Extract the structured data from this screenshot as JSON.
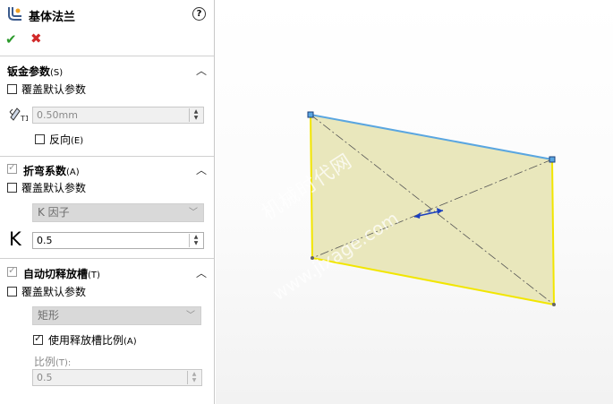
{
  "header": {
    "title": "基体法兰",
    "help_icon": "?"
  },
  "actions": {
    "ok_icon": "✔",
    "cancel_icon": "✖"
  },
  "sheet_metal_params": {
    "heading": "钣金参数",
    "heading_key": "(S)",
    "override_label": "覆盖默认参数",
    "override_checked": false,
    "thickness_value": "0.50mm",
    "reverse_label": "反向",
    "reverse_key": "(E)",
    "reverse_checked": false
  },
  "bend_allowance": {
    "heading": "折弯系数",
    "heading_key": "(A)",
    "enabled_checked": true,
    "override_label": "覆盖默认参数",
    "override_checked": false,
    "type_value": "K 因子",
    "k_symbol": "K",
    "k_value": "0.5"
  },
  "auto_relief": {
    "heading": "自动切释放槽",
    "heading_key": "(T)",
    "enabled_checked": true,
    "override_label": "覆盖默认参数",
    "override_checked": false,
    "type_value": "矩形",
    "use_ratio_label": "使用释放槽比例",
    "use_ratio_key": "(A)",
    "use_ratio_checked": true,
    "ratio_label": "比例",
    "ratio_key": "(T):",
    "ratio_value": "0.5"
  },
  "viewport": {
    "watermark_line1": "机械时代网",
    "watermark_line2": "www.jixage.com"
  },
  "colors": {
    "face_fill": "#e8e6b8",
    "edge_selected": "#5aa6e0",
    "edge_highlight": "#f2e600",
    "construction": "#555555",
    "arrow": "#1a3fbf"
  }
}
